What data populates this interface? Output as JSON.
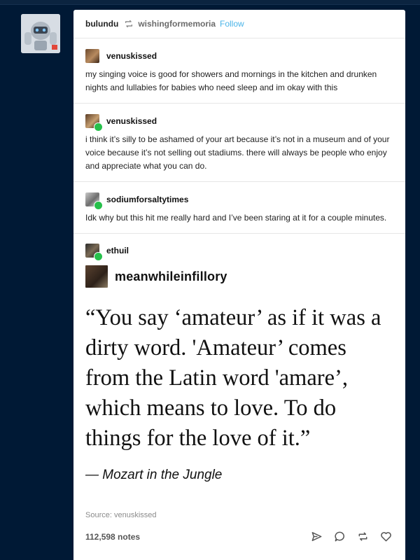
{
  "header": {
    "user": "bulundu",
    "source_user": "wishingformemoria",
    "follow_label": "Follow"
  },
  "posts": [
    {
      "user": "venuskissed",
      "text": "my singing voice is good for showers and mornings in the kitchen and drunken nights and lullabies for babies who need sleep and im okay with this"
    },
    {
      "user": "venuskissed",
      "text": "i think it’s silly to be ashamed of your art because it’s not in a museum and of your voice because it’s not selling out stadiums. there will always be people who enjoy and appreciate what you can do."
    },
    {
      "user": "sodiumforsaltytimes",
      "text": "Idk why but this hit me really hard and I’ve been staring at it for a couple minutes."
    },
    {
      "user": "ethuil"
    }
  ],
  "embedded": {
    "author": "meanwhileinfillory",
    "quote": "“You say ‘amateur’ as if it was a dirty word. 'Amateur’ comes from the Latin word 'amare’, which means to love. To do things for the love of it.”",
    "attribution": "— Mozart in the Jungle"
  },
  "source_label": "Source:  venuskissed",
  "notes": "112,598 notes",
  "icons": [
    "reblog-icon",
    "share-icon",
    "reply-icon",
    "reblog-icon",
    "like-icon"
  ],
  "colors": {
    "background": "#001935",
    "follow": "#4ab4e8",
    "badge": "#27c04b"
  }
}
